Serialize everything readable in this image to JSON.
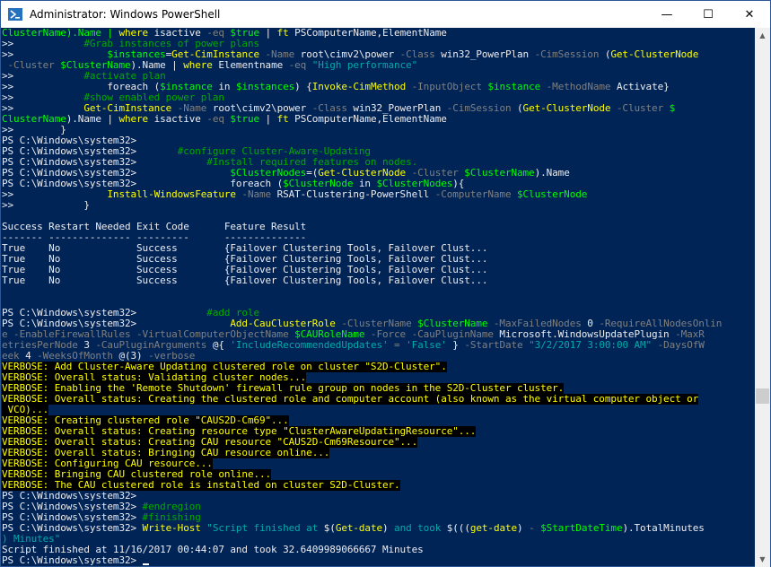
{
  "window": {
    "title": "Administrator: Windows PowerShell",
    "controls": {
      "minimize": "—",
      "maximize": "☐",
      "close": "✕"
    }
  },
  "scrollbar": {
    "up": "▲",
    "down": "▼",
    "position": 0.7
  },
  "colors": {
    "background": "#012456",
    "default": "#eeedf0",
    "keyword": "#ffff00",
    "cmdlet": "#ffff00",
    "parameter": "#808080",
    "variable": "#00ff00",
    "string": "#00aaaa",
    "comment": "#00aa00",
    "verbose_fg": "#ffff00",
    "verbose_bg": "#000000"
  },
  "lines": [
    [
      [
        "ClusterName).Name | ",
        "v"
      ],
      [
        "where",
        "c"
      ],
      [
        " isactive ",
        "d"
      ],
      [
        "-eq",
        "p"
      ],
      [
        " $true",
        "v"
      ],
      [
        " | ",
        "d"
      ],
      [
        "ft",
        "c"
      ],
      [
        " PSComputerName,ElementName",
        "d"
      ]
    ],
    [
      [
        ">>            ",
        "d"
      ],
      [
        "#Grab instances of power plans",
        "m"
      ]
    ],
    [
      [
        ">>                ",
        "d"
      ],
      [
        "$instances",
        "v"
      ],
      [
        "=",
        "d"
      ],
      [
        "Get-CimInstance",
        "c"
      ],
      [
        " -Name",
        "p"
      ],
      [
        " root\\cimv2\\power ",
        "d"
      ],
      [
        "-Class",
        "p"
      ],
      [
        " win32_PowerPlan ",
        "d"
      ],
      [
        "-CimSession",
        "p"
      ],
      [
        " (",
        "d"
      ],
      [
        "Get-ClusterNode",
        "c"
      ]
    ],
    [
      [
        " -Cluster ",
        "p"
      ],
      [
        "$ClusterName",
        "v"
      ],
      [
        ").Name | ",
        "d"
      ],
      [
        "where",
        "c"
      ],
      [
        " Elementname ",
        "d"
      ],
      [
        "-eq",
        "p"
      ],
      [
        " \"High performance\"",
        "s"
      ]
    ],
    [
      [
        ">>            ",
        "d"
      ],
      [
        "#activate plan",
        "m"
      ]
    ],
    [
      [
        ">>                ",
        "d"
      ],
      [
        "foreach",
        "d"
      ],
      [
        " (",
        "d"
      ],
      [
        "$instance",
        "v"
      ],
      [
        " in ",
        "d"
      ],
      [
        "$instances",
        "v"
      ],
      [
        ") {",
        "d"
      ],
      [
        "Invoke-CimMethod",
        "c"
      ],
      [
        " -InputObject",
        "p"
      ],
      [
        " $instance",
        "v"
      ],
      [
        " -MethodName",
        "p"
      ],
      [
        " Activate}",
        "d"
      ]
    ],
    [
      [
        ">>            ",
        "d"
      ],
      [
        "#show enabled power plan",
        "m"
      ]
    ],
    [
      [
        ">>            ",
        "d"
      ],
      [
        "Get-CimInstance",
        "c"
      ],
      [
        " -Name",
        "p"
      ],
      [
        " root\\cimv2\\power ",
        "d"
      ],
      [
        "-Class",
        "p"
      ],
      [
        " win32_PowerPlan ",
        "d"
      ],
      [
        "-CimSession",
        "p"
      ],
      [
        " (",
        "d"
      ],
      [
        "Get-ClusterNode",
        "c"
      ],
      [
        " -Cluster",
        "p"
      ],
      [
        " $",
        "v"
      ]
    ],
    [
      [
        "ClusterName",
        "v"
      ],
      [
        ").Name | ",
        "d"
      ],
      [
        "where",
        "c"
      ],
      [
        " isactive ",
        "d"
      ],
      [
        "-eq",
        "p"
      ],
      [
        " $true",
        "v"
      ],
      [
        " | ",
        "d"
      ],
      [
        "ft",
        "c"
      ],
      [
        " PSComputerName,ElementName",
        "d"
      ]
    ],
    [
      [
        ">>        }",
        "d"
      ]
    ],
    [
      [
        "PS C:\\Windows\\system32>",
        "d"
      ]
    ],
    [
      [
        "PS C:\\Windows\\system32>       ",
        "d"
      ],
      [
        "#configure Cluster-Aware-Updating",
        "m"
      ]
    ],
    [
      [
        "PS C:\\Windows\\system32>            ",
        "d"
      ],
      [
        "#Install required features on nodes.",
        "m"
      ]
    ],
    [
      [
        "PS C:\\Windows\\system32>                ",
        "d"
      ],
      [
        "$ClusterNodes",
        "v"
      ],
      [
        "=(",
        "d"
      ],
      [
        "Get-ClusterNode",
        "c"
      ],
      [
        " -Cluster",
        "p"
      ],
      [
        " $ClusterName",
        "v"
      ],
      [
        ").Name",
        "d"
      ]
    ],
    [
      [
        "PS C:\\Windows\\system32>                ",
        "d"
      ],
      [
        "foreach",
        "d"
      ],
      [
        " (",
        "d"
      ],
      [
        "$ClusterNode",
        "v"
      ],
      [
        " in ",
        "d"
      ],
      [
        "$ClusterNodes",
        "v"
      ],
      [
        "){",
        "d"
      ]
    ],
    [
      [
        ">>                ",
        "d"
      ],
      [
        "Install-WindowsFeature",
        "c"
      ],
      [
        " -Name",
        "p"
      ],
      [
        " RSAT-Clustering-PowerShell ",
        "d"
      ],
      [
        "-ComputerName",
        "p"
      ],
      [
        " $ClusterNode",
        "v"
      ]
    ],
    [
      [
        ">>            }",
        "d"
      ]
    ],
    [
      [
        "",
        "d"
      ]
    ],
    [
      [
        "Success Restart Needed Exit Code      Feature Result",
        "d"
      ]
    ],
    [
      [
        "------- -------------- ---------      --------------",
        "d"
      ]
    ],
    [
      [
        "True    No             Success        {Failover Clustering Tools, Failover Clust...",
        "d"
      ]
    ],
    [
      [
        "True    No             Success        {Failover Clustering Tools, Failover Clust...",
        "d"
      ]
    ],
    [
      [
        "True    No             Success        {Failover Clustering Tools, Failover Clust...",
        "d"
      ]
    ],
    [
      [
        "True    No             Success        {Failover Clustering Tools, Failover Clust...",
        "d"
      ]
    ],
    [
      [
        "",
        "d"
      ]
    ],
    [
      [
        "",
        "d"
      ]
    ],
    [
      [
        "PS C:\\Windows\\system32>            ",
        "d"
      ],
      [
        "#add role",
        "m"
      ]
    ],
    [
      [
        "PS C:\\Windows\\system32>                ",
        "d"
      ],
      [
        "Add-CauClusterRole",
        "c"
      ],
      [
        " -ClusterName",
        "p"
      ],
      [
        " $ClusterName",
        "v"
      ],
      [
        " -MaxFailedNodes",
        "p"
      ],
      [
        " 0 ",
        "d"
      ],
      [
        "-RequireAllNodesOnlin",
        "p"
      ]
    ],
    [
      [
        "e -EnableFirewallRules -VirtualComputerObjectName",
        "p"
      ],
      [
        " $CAURoleName",
        "v"
      ],
      [
        " -Force -CauPluginName",
        "p"
      ],
      [
        " Microsoft.WindowsUpdatePlugin ",
        "d"
      ],
      [
        "-MaxR",
        "p"
      ]
    ],
    [
      [
        "etriesPerNode",
        "p"
      ],
      [
        " 3 ",
        "d"
      ],
      [
        "-CauPluginArguments",
        "p"
      ],
      [
        " @{ ",
        "d"
      ],
      [
        "'IncludeRecommendedUpdates'",
        "s"
      ],
      [
        " = ",
        "p"
      ],
      [
        "'False'",
        "s"
      ],
      [
        " } ",
        "d"
      ],
      [
        "-StartDate",
        "p"
      ],
      [
        " \"3/2/2017 3:00:00 AM\"",
        "s"
      ],
      [
        " -DaysOfW",
        "p"
      ]
    ],
    [
      [
        "eek",
        "p"
      ],
      [
        " 4 ",
        "d"
      ],
      [
        "-WeeksOfMonth",
        "p"
      ],
      [
        " @(3) ",
        "d"
      ],
      [
        "-verbose",
        "p"
      ]
    ],
    [
      [
        "VERBOSE: Add Cluster-Aware Updating clustered role on cluster \"S2D-Cluster\".",
        "V"
      ]
    ],
    [
      [
        "VERBOSE: Overall status: Validating cluster nodes...",
        "V"
      ]
    ],
    [
      [
        "VERBOSE: Enabling the 'Remote Shutdown' firewall rule group on nodes in the S2D-Cluster cluster.",
        "V"
      ]
    ],
    [
      [
        "VERBOSE: Overall status: Creating the clustered role and computer account (also known as the virtual computer object or",
        "V"
      ]
    ],
    [
      [
        " VCO)...",
        "V"
      ]
    ],
    [
      [
        "VERBOSE: Creating clustered role \"CAUS2D-Cm69\"...",
        "V"
      ]
    ],
    [
      [
        "VERBOSE: Overall status: Creating resource type \"ClusterAwareUpdatingResource\"...",
        "V"
      ]
    ],
    [
      [
        "VERBOSE: Overall status: Creating CAU resource \"CAUS2D-Cm69Resource\"...",
        "V"
      ]
    ],
    [
      [
        "VERBOSE: Overall status: Bringing CAU resource online...",
        "V"
      ]
    ],
    [
      [
        "VERBOSE: Configuring CAU resource...",
        "V"
      ]
    ],
    [
      [
        "VERBOSE: Bringing CAU clustered role online...",
        "V"
      ]
    ],
    [
      [
        "VERBOSE: The CAU clustered role is installed on cluster S2D-Cluster.",
        "V"
      ]
    ],
    [
      [
        "PS C:\\Windows\\system32>",
        "d"
      ]
    ],
    [
      [
        "PS C:\\Windows\\system32> ",
        "d"
      ],
      [
        "#endregion",
        "m"
      ]
    ],
    [
      [
        "PS C:\\Windows\\system32> ",
        "d"
      ],
      [
        "#finishing",
        "m"
      ]
    ],
    [
      [
        "PS C:\\Windows\\system32> ",
        "d"
      ],
      [
        "Write-Host",
        "c"
      ],
      [
        " \"Script finished at ",
        "s"
      ],
      [
        "$(",
        "d"
      ],
      [
        "Get-date",
        "c"
      ],
      [
        ")",
        "d"
      ],
      [
        " and took ",
        "s"
      ],
      [
        "$(((",
        "d"
      ],
      [
        "get-date",
        "c"
      ],
      [
        ")",
        "d"
      ],
      [
        " - ",
        "p"
      ],
      [
        "$StartDateTime",
        "v"
      ],
      [
        ").TotalMinutes",
        "d"
      ]
    ],
    [
      [
        ") Minutes\"",
        "s"
      ]
    ],
    [
      [
        "Script finished at 11/16/2017 00:44:07 and took 32.6409989066667 Minutes",
        "d"
      ]
    ],
    [
      [
        "PS C:\\Windows\\system32> ",
        "d"
      ]
    ]
  ]
}
